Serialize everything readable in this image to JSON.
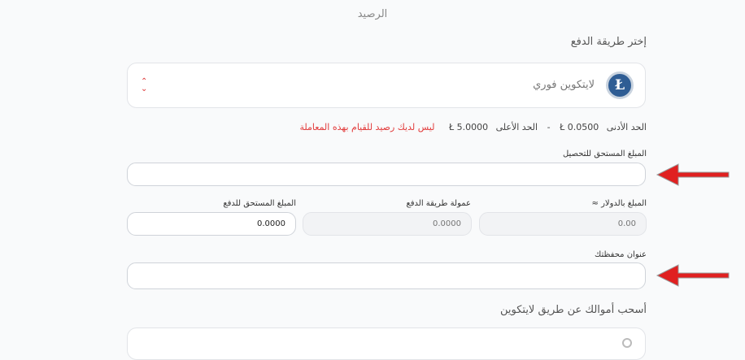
{
  "balance_title": "الرصيد",
  "payment": {
    "section_label": "إختر طريقة الدفع",
    "selected_method": "لايتكوين فوري",
    "coin_symbol": "Ł",
    "select_arrows": "⌃⌄"
  },
  "limits": {
    "min_label": "الحد الأدنى",
    "min_value": "Ł 0.0500",
    "separator": "-",
    "max_label": "الحد الأعلى",
    "max_value": "Ł 5.0000",
    "error": "ليس لديك رصيد للقيام بهذه المعاملة"
  },
  "amount_due_collect": {
    "label": "المبلغ المستحق للتحصيل",
    "value": ""
  },
  "amount_usd": {
    "label": "المبلغ بالدولار ≈",
    "placeholder": "0.00"
  },
  "payment_fee": {
    "label": "عمولة طريقة الدفع",
    "placeholder": "0.0000"
  },
  "amount_due_pay": {
    "label": "المبلغ المستحق للدفع",
    "value": "0.0000"
  },
  "wallet_address": {
    "label": "عنوان محفظتك",
    "value": ""
  },
  "withdraw": {
    "label": "أسحب أموالك عن طريق لايتكوين"
  },
  "colors": {
    "error": "#e23b3b",
    "arrow": "#e02020",
    "coin": "#2f5d94"
  }
}
